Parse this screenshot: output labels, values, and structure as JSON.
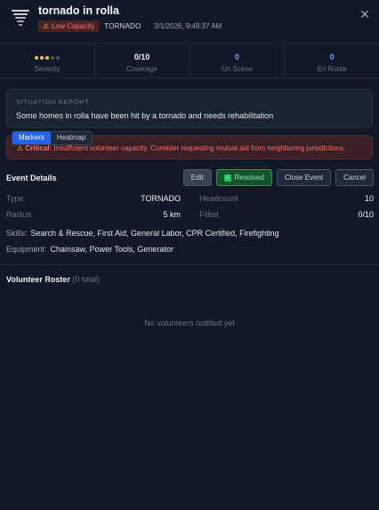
{
  "header": {
    "title": "tornado in rolla",
    "capacity_badge": "Low Capacity",
    "type": "TORNADO",
    "separator": "·",
    "timestamp": "3/1/2026, 9:48:37 AM",
    "icon": "tornado-icon",
    "close_icon": "close-icon"
  },
  "stats": {
    "severity": {
      "label": "Severity",
      "level": 3,
      "max": 5
    },
    "coverage": {
      "value": "0/10",
      "label": "Coverage"
    },
    "on_scene": {
      "value": "0",
      "label": "On Scene"
    },
    "en_route": {
      "value": "0",
      "label": "En Route"
    }
  },
  "situation_report": {
    "title": "SITUATION REPORT",
    "text": "Some homes in rolla have been hit by a tornado and needs rehabilitation"
  },
  "alert": {
    "prefix": "Critical:",
    "text": "Insufficient volunteer capacity. Consider requesting mutual aid from neighboring jurisdictions."
  },
  "map_toggle": {
    "markers": "Markers",
    "heatmap": "Heatmap",
    "active": "markers"
  },
  "event_details": {
    "title": "Event Details",
    "buttons": {
      "edit": "Edit",
      "resolved": "Resolved",
      "close_event": "Close Event",
      "cancel": "Cancel"
    },
    "type_label": "Type",
    "type_value": "TORNADO",
    "radius_label": "Radius",
    "radius_value": "5 km",
    "headcount_label": "Headcount",
    "headcount_value": "10",
    "filled_label": "Filled",
    "filled_value": "0/10",
    "skills_label": "Skills:",
    "skills_value": "Search & Rescue, First Aid, General Labor, CPR Certified, Firefighting",
    "equipment_label": "Equipment:",
    "equipment_value": "Chainsaw, Power Tools, Generator"
  },
  "roster": {
    "title": "Volunteer Roster",
    "count": "(0 total)",
    "empty": "No volunteers notified yet"
  },
  "colors": {
    "background": "#111827",
    "accent_blue": "#2563eb",
    "danger": "#f87171",
    "warning": "#fbbf24",
    "success": "#22c55e",
    "on_scene": "#a78bfa",
    "en_route": "#60a5fa"
  }
}
